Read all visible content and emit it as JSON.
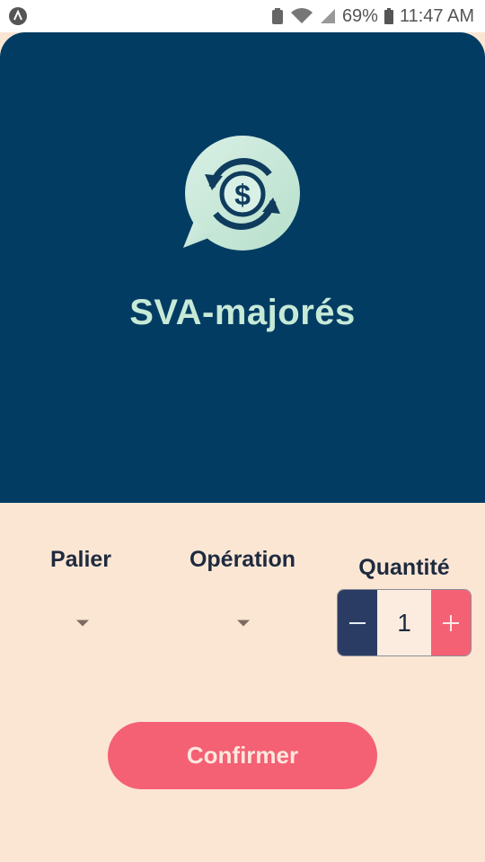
{
  "status_bar": {
    "battery": "69%",
    "time": "11:47 AM"
  },
  "app": {
    "title": "SVA-majorés",
    "logo_icon": "currency-exchange-chat-icon"
  },
  "form": {
    "palier_label": "Palier",
    "operation_label": "Opération",
    "quantite_label": "Quantité",
    "quantity_value": "1",
    "confirm_label": "Confirmer"
  },
  "colors": {
    "hero_bg": "#023c63",
    "page_bg": "#fbe6d4",
    "accent": "#f46174",
    "title": "#c7ead7"
  }
}
